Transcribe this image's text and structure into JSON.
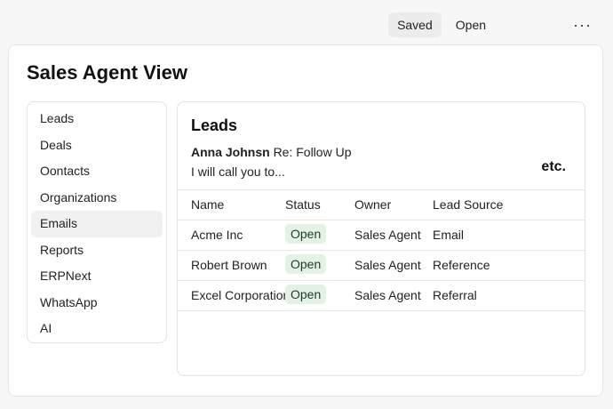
{
  "topbar": {
    "saved_label": "Saved",
    "open_label": "Open",
    "more_icon": "more-horizontal-icon",
    "more_glyph": "···"
  },
  "page": {
    "title": "Sales Agent View"
  },
  "sidebar": {
    "items": [
      {
        "label": "Leads"
      },
      {
        "label": "Deals"
      },
      {
        "label": "Oontacts"
      },
      {
        "label": "Organizations"
      },
      {
        "label": "Emails",
        "active": true
      },
      {
        "label": "Reports"
      },
      {
        "label": "ERPNext"
      },
      {
        "label": "WhatsApp"
      },
      {
        "label": "AI"
      }
    ]
  },
  "panel": {
    "title": "Leads",
    "email": {
      "sender": "Anna Johnsn",
      "subject": "Re: Follow Up",
      "preview": "I will call you to..."
    },
    "etc_label": "etc.",
    "table": {
      "headers": [
        "Name",
        "Status",
        "Owner",
        "Lead Source"
      ],
      "rows": [
        {
          "name": "Acme Inc",
          "status": "Open",
          "owner": "Sales Agent",
          "source": "Email"
        },
        {
          "name": "Robert Brown",
          "status": "Open",
          "owner": "Sales Agent",
          "source": "Reference"
        },
        {
          "name": "Excel Corporation",
          "status": "Open",
          "owner": "Sales Agent",
          "source": "Referral"
        }
      ]
    }
  },
  "colors": {
    "status_open_bg": "#e4f2e6",
    "active_nav_bg": "#f1f1f1"
  }
}
